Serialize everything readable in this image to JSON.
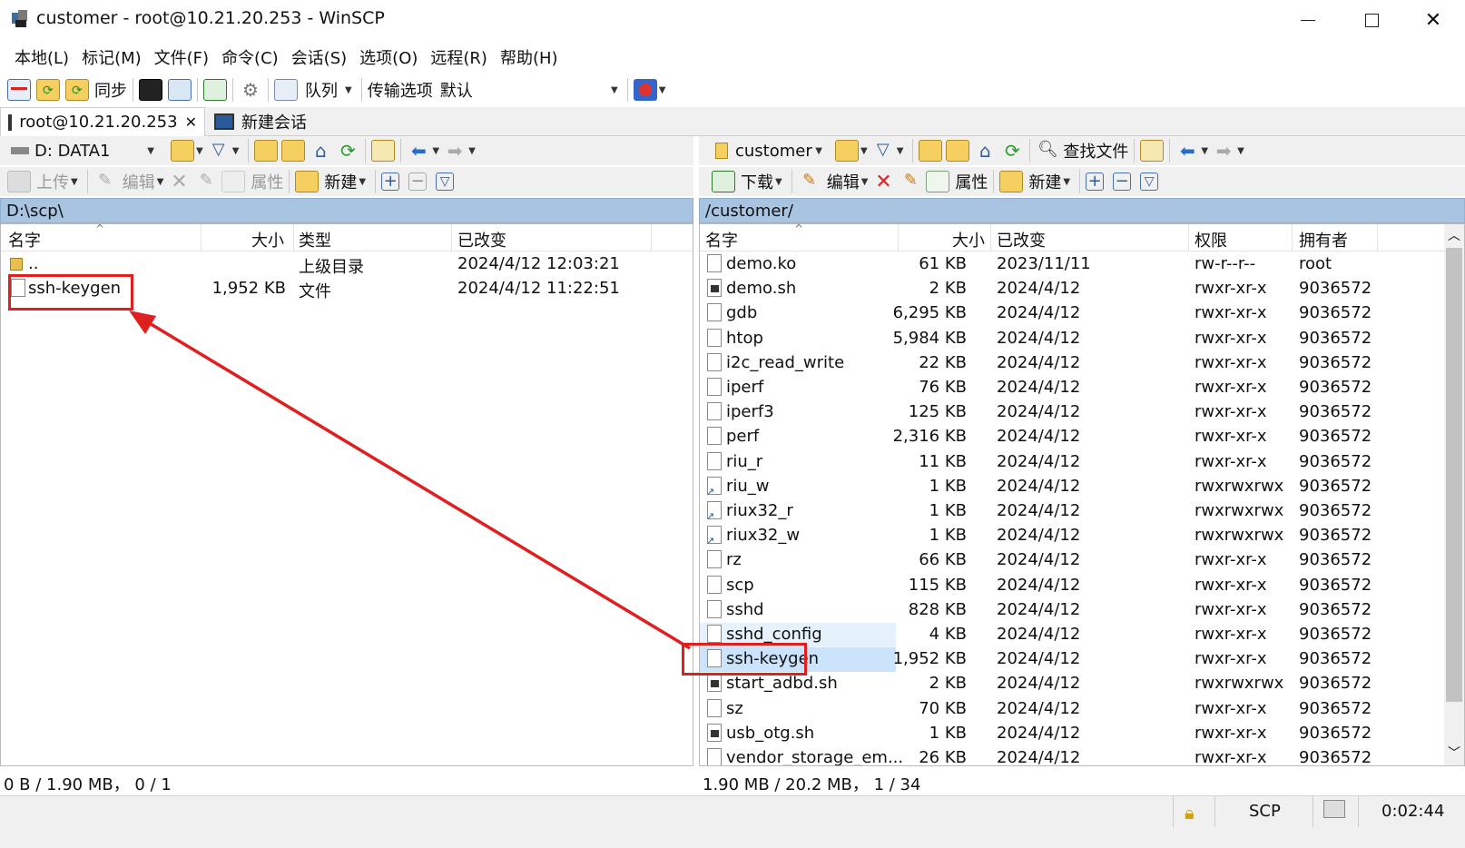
{
  "window": {
    "title": "customer - root@10.21.20.253 - WinSCP"
  },
  "menu": [
    "本地(L)",
    "标记(M)",
    "文件(F)",
    "命令(C)",
    "会话(S)",
    "选项(O)",
    "远程(R)",
    "帮助(H)"
  ],
  "toolbar": {
    "sync_label": "同步",
    "queue_label": "队列",
    "transfer_label": "传输选项",
    "transfer_value": "默认"
  },
  "tabs": [
    {
      "label": "root@10.21.20.253"
    },
    {
      "label": "新建会话"
    }
  ],
  "left": {
    "drive": "D: DATA1",
    "path": "D:\\scp\\",
    "actions": {
      "upload": "上传",
      "edit": "编辑",
      "props": "属性",
      "new": "新建"
    },
    "columns": {
      "name": "名字",
      "size": "大小",
      "type": "类型",
      "changed": "已改变"
    },
    "files": [
      {
        "name": "..",
        "size": "",
        "type": "上级目录",
        "changed": "2024/4/12  12:03:21"
      },
      {
        "name": "ssh-keygen",
        "size": "1,952 KB",
        "type": "文件",
        "changed": "2024/4/12  11:22:51"
      }
    ],
    "status": "0 B / 1.90 MB，  0 / 1"
  },
  "right": {
    "folder": "customer",
    "find_label": "查找文件",
    "path": "/customer/",
    "actions": {
      "download": "下载",
      "edit": "编辑",
      "props": "属性",
      "new": "新建"
    },
    "columns": {
      "name": "名字",
      "size": "大小",
      "changed": "已改变",
      "rights": "权限",
      "owner": "拥有者"
    },
    "files": [
      {
        "name": "demo.ko",
        "size": "61 KB",
        "changed": "2023/11/11",
        "rights": "rw-r--r--",
        "owner": "root",
        "icon": "file"
      },
      {
        "name": "demo.sh",
        "size": "2 KB",
        "changed": "2024/4/12",
        "rights": "rwxr-xr-x",
        "owner": "9036572",
        "icon": "script"
      },
      {
        "name": "gdb",
        "size": "6,295 KB",
        "changed": "2024/4/12",
        "rights": "rwxr-xr-x",
        "owner": "9036572",
        "icon": "file"
      },
      {
        "name": "htop",
        "size": "5,984 KB",
        "changed": "2024/4/12",
        "rights": "rwxr-xr-x",
        "owner": "9036572",
        "icon": "file"
      },
      {
        "name": "i2c_read_write",
        "size": "22 KB",
        "changed": "2024/4/12",
        "rights": "rwxr-xr-x",
        "owner": "9036572",
        "icon": "file"
      },
      {
        "name": "iperf",
        "size": "76 KB",
        "changed": "2024/4/12",
        "rights": "rwxr-xr-x",
        "owner": "9036572",
        "icon": "file"
      },
      {
        "name": "iperf3",
        "size": "125 KB",
        "changed": "2024/4/12",
        "rights": "rwxr-xr-x",
        "owner": "9036572",
        "icon": "file"
      },
      {
        "name": "perf",
        "size": "2,316 KB",
        "changed": "2024/4/12",
        "rights": "rwxr-xr-x",
        "owner": "9036572",
        "icon": "file"
      },
      {
        "name": "riu_r",
        "size": "11 KB",
        "changed": "2024/4/12",
        "rights": "rwxr-xr-x",
        "owner": "9036572",
        "icon": "file"
      },
      {
        "name": "riu_w",
        "size": "1 KB",
        "changed": "2024/4/12",
        "rights": "rwxrwxrwx",
        "owner": "9036572",
        "icon": "link"
      },
      {
        "name": "riux32_r",
        "size": "1 KB",
        "changed": "2024/4/12",
        "rights": "rwxrwxrwx",
        "owner": "9036572",
        "icon": "link"
      },
      {
        "name": "riux32_w",
        "size": "1 KB",
        "changed": "2024/4/12",
        "rights": "rwxrwxrwx",
        "owner": "9036572",
        "icon": "link"
      },
      {
        "name": "rz",
        "size": "66 KB",
        "changed": "2024/4/12",
        "rights": "rwxr-xr-x",
        "owner": "9036572",
        "icon": "file"
      },
      {
        "name": "scp",
        "size": "115 KB",
        "changed": "2024/4/12",
        "rights": "rwxr-xr-x",
        "owner": "9036572",
        "icon": "file"
      },
      {
        "name": "sshd",
        "size": "828 KB",
        "changed": "2024/4/12",
        "rights": "rwxr-xr-x",
        "owner": "9036572",
        "icon": "file"
      },
      {
        "name": "sshd_config",
        "size": "4 KB",
        "changed": "2024/4/12",
        "rights": "rwxr-xr-x",
        "owner": "9036572",
        "icon": "file"
      },
      {
        "name": "ssh-keygen",
        "size": "1,952 KB",
        "changed": "2024/4/12",
        "rights": "rwxr-xr-x",
        "owner": "9036572",
        "icon": "file"
      },
      {
        "name": "start_adbd.sh",
        "size": "2 KB",
        "changed": "2024/4/12",
        "rights": "rwxrwxrwx",
        "owner": "9036572",
        "icon": "script"
      },
      {
        "name": "sz",
        "size": "70 KB",
        "changed": "2024/4/12",
        "rights": "rwxr-xr-x",
        "owner": "9036572",
        "icon": "file"
      },
      {
        "name": "usb_otg.sh",
        "size": "1 KB",
        "changed": "2024/4/12",
        "rights": "rwxr-xr-x",
        "owner": "9036572",
        "icon": "script"
      },
      {
        "name": "vendor_storage_em...",
        "size": "26 KB",
        "changed": "2024/4/12",
        "rights": "rwxr-xr-x",
        "owner": "9036572",
        "icon": "file"
      }
    ],
    "status": "1.90 MB / 20.2 MB，  1 / 34"
  },
  "statusbar": {
    "protocol": "SCP",
    "elapsed": "0:02:44"
  },
  "colors": {
    "accent_red": "#e02020",
    "path_bg": "#a8c4e0",
    "selection": "#cce4fb"
  }
}
